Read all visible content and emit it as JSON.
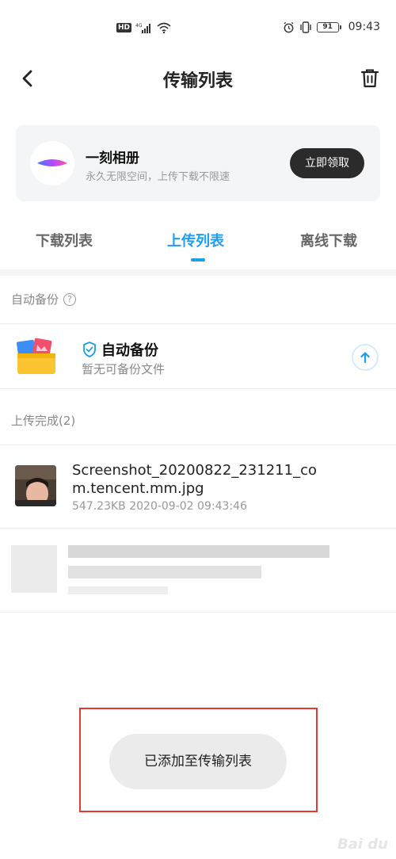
{
  "status_bar": {
    "hd_badge": "HD",
    "network": "4G",
    "battery": "91",
    "time": "09:43"
  },
  "header": {
    "title": "传输列表",
    "back_icon": "chevron-left-icon",
    "trash_icon": "trash-icon"
  },
  "promo": {
    "title": "一刻相册",
    "subtitle": "永久无限空间，上传下载不限速",
    "button": "立即领取"
  },
  "tabs": [
    {
      "label": "下载列表",
      "active": false
    },
    {
      "label": "上传列表",
      "active": true
    },
    {
      "label": "离线下载",
      "active": false
    }
  ],
  "auto_backup_section": {
    "label": "自动备份",
    "help": "?"
  },
  "backup_item": {
    "title": "自动备份",
    "subtitle": "暂无可备份文件"
  },
  "upload_done_section": {
    "label": "上传完成(2)"
  },
  "files": [
    {
      "name": "Screenshot_20200822_231211_com.tencent.mm.jpg",
      "meta": "547.23KB 2020-09-02 09:43:46"
    }
  ],
  "toast": {
    "message": "已添加至传输列表"
  },
  "colors": {
    "accent": "#1d9ef0",
    "highlight": "#e53935",
    "button_dark": "#2b2b2b"
  }
}
